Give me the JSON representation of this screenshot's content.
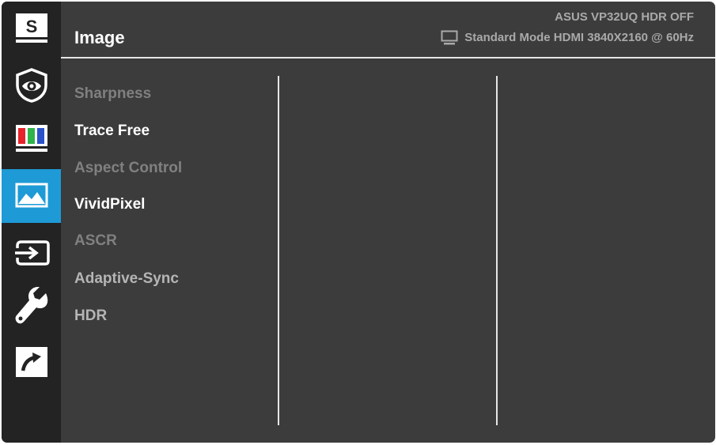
{
  "header": {
    "title": "Image",
    "status_line1": "ASUS  VP32UQ  HDR OFF",
    "status_line2": "Standard Mode HDMI 3840X2160 @ 60Hz",
    "monitor_icon": "monitor-icon"
  },
  "sidebar": {
    "items": [
      {
        "name": "splendid",
        "icon": "splendid-s-icon",
        "label": "S"
      },
      {
        "name": "blue-light-filter",
        "icon": "eye-shield-icon"
      },
      {
        "name": "color",
        "icon": "color-bars-icon"
      },
      {
        "name": "image",
        "icon": "image-mountain-icon",
        "active": true
      },
      {
        "name": "input-select",
        "icon": "input-arrow-icon"
      },
      {
        "name": "system-setup",
        "icon": "wrench-icon"
      },
      {
        "name": "shortcut",
        "icon": "shortcut-arrow-icon"
      }
    ]
  },
  "menu": {
    "items": [
      {
        "label": "Sharpness",
        "state": "disabled"
      },
      {
        "label": "Trace Free",
        "state": "enabled"
      },
      {
        "label": "Aspect Control",
        "state": "disabled"
      },
      {
        "label": "VividPixel",
        "state": "enabled"
      },
      {
        "label": "ASCR",
        "state": "disabled"
      },
      {
        "label": "Adaptive-Sync",
        "state": "dim"
      },
      {
        "label": "HDR",
        "state": "dim"
      }
    ]
  },
  "colors": {
    "panel": "#3c3c3c",
    "sidebar": "#232323",
    "accent": "#1e9ad6",
    "text_enabled": "#ffffff",
    "text_disabled": "#808080"
  }
}
